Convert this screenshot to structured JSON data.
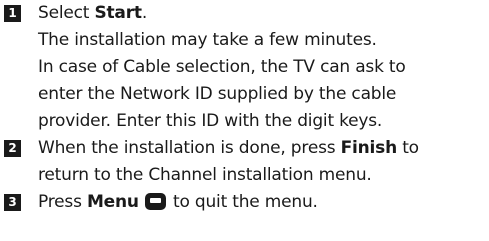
{
  "steps": [
    {
      "number": "1",
      "lines": [
        {
          "pre": "Select ",
          "bold": "Start",
          "post": "."
        },
        {
          "text": "The installation may take a few minutes."
        },
        {
          "text": "In case of Cable selection, the TV can ask to"
        },
        {
          "text": "enter the Network ID supplied by the cable"
        },
        {
          "text": "provider. Enter this ID with the digit keys."
        }
      ]
    },
    {
      "number": "2",
      "lines": [
        {
          "pre": "When the installation is done, press ",
          "bold": "Finish",
          "post": " to"
        },
        {
          "text": "return to the Channel installation menu."
        }
      ]
    },
    {
      "number": "3",
      "lines": [
        {
          "pre": "Press ",
          "bold": "Menu",
          "icon": "menu-icon",
          "post": " to quit the menu."
        }
      ]
    }
  ]
}
